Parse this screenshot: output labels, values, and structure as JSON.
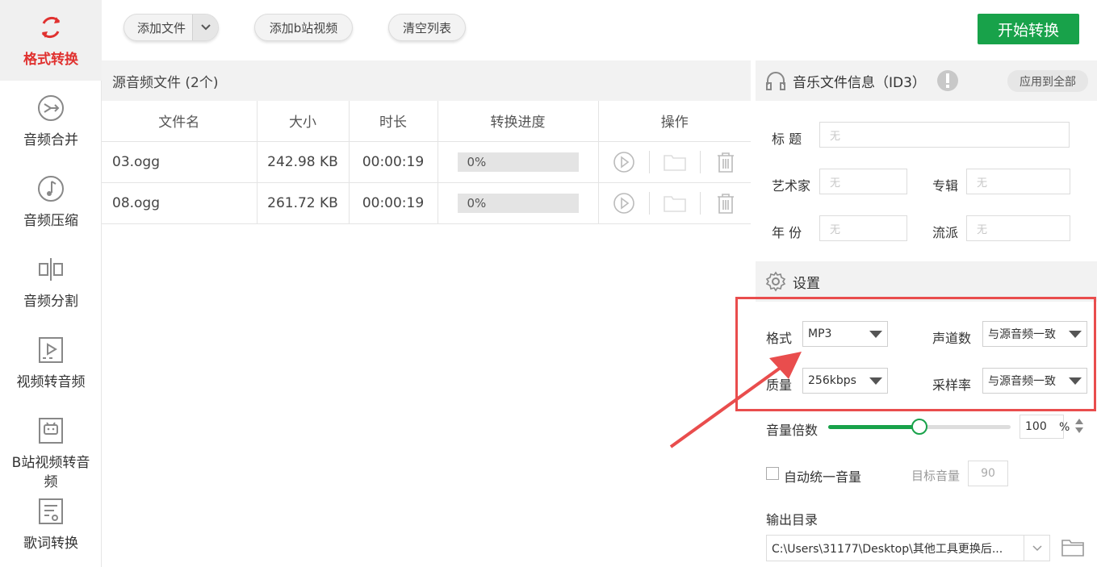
{
  "sidebar": {
    "items": [
      {
        "label": "格式转换",
        "icon": "refresh-icon",
        "active": true
      },
      {
        "label": "音频合并",
        "icon": "merge-icon"
      },
      {
        "label": "音频压缩",
        "icon": "music-note-icon"
      },
      {
        "label": "音频分割",
        "icon": "split-icon"
      },
      {
        "label": "视频转音频",
        "icon": "video-play-icon"
      },
      {
        "label": "B站视频转音频",
        "icon": "bilibili-icon"
      },
      {
        "label": "歌词转换",
        "icon": "lyrics-icon"
      }
    ]
  },
  "toolbar": {
    "add_file": "添加文件",
    "add_bilibili": "添加b站视频",
    "clear_list": "清空列表",
    "start": "开始转换"
  },
  "file_panel": {
    "header": "源音频文件 (2个)",
    "columns": [
      "文件名",
      "大小",
      "时长",
      "转换进度",
      "操作"
    ],
    "rows": [
      {
        "name": "03.ogg",
        "size": "242.98 KB",
        "duration": "00:00:19",
        "progress": "0%"
      },
      {
        "name": "08.ogg",
        "size": "261.72 KB",
        "duration": "00:00:19",
        "progress": "0%"
      }
    ]
  },
  "id3": {
    "title": "音乐文件信息（ID3）",
    "apply_all": "应用到全部",
    "fields": {
      "title_label": "标 题",
      "artist_label": "艺术家",
      "album_label": "专辑",
      "year_label": "年 份",
      "genre_label": "流派",
      "placeholder": "无"
    }
  },
  "settings": {
    "title": "设置",
    "format_label": "格式",
    "format_value": "MP3",
    "channels_label": "声道数",
    "channels_value": "与源音频一致",
    "quality_label": "质量",
    "quality_value": "256kbps",
    "samplerate_label": "采样率",
    "samplerate_value": "与源音频一致",
    "volume_label": "音量倍数",
    "volume_value": "100",
    "volume_unit": "%",
    "volume_fraction": 0.5,
    "auto_volume_label": "自动统一音量",
    "target_volume_label": "目标音量",
    "target_volume_value": "90",
    "output_label": "输出目录",
    "output_path": "C:\\Users\\31177\\Desktop\\其他工具更换后..."
  },
  "colors": {
    "accent_green": "#18a24a",
    "active_red": "#e0312f",
    "annotation_red": "#e94d4d"
  }
}
